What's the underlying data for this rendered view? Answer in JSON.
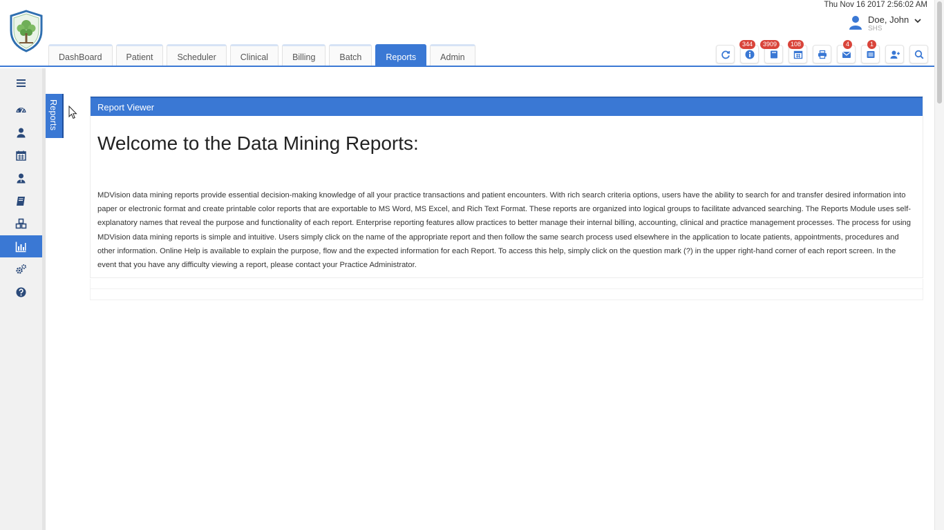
{
  "header": {
    "datetime": "Thu Nov 16 2017 2:56:02 AM",
    "user_name": "Doe, John",
    "user_org": "SHS",
    "logo_icon": "tree-shield-logo"
  },
  "tabs": [
    {
      "label": "DashBoard",
      "active": false
    },
    {
      "label": "Patient",
      "active": false
    },
    {
      "label": "Scheduler",
      "active": false
    },
    {
      "label": "Clinical",
      "active": false
    },
    {
      "label": "Billing",
      "active": false
    },
    {
      "label": "Batch",
      "active": false
    },
    {
      "label": "Reports",
      "active": true
    },
    {
      "label": "Admin",
      "active": false
    }
  ],
  "toolbar": [
    {
      "icon": "refresh-icon",
      "badge": ""
    },
    {
      "icon": "info-icon",
      "badge": "344"
    },
    {
      "icon": "book-icon",
      "badge": "3909"
    },
    {
      "icon": "calendar-icon",
      "badge": "108"
    },
    {
      "icon": "print-icon",
      "badge": ""
    },
    {
      "icon": "mail-icon",
      "badge": "4"
    },
    {
      "icon": "list-icon",
      "badge": "1"
    },
    {
      "icon": "add-user-icon",
      "badge": ""
    },
    {
      "icon": "search-icon",
      "badge": ""
    }
  ],
  "sidebar": [
    {
      "icon": "menu-icon",
      "active": false
    },
    {
      "icon": "dashboard-icon",
      "active": false
    },
    {
      "icon": "patient-icon",
      "active": false
    },
    {
      "icon": "calendar-icon",
      "active": false
    },
    {
      "icon": "clinical-user-icon",
      "active": false
    },
    {
      "icon": "billing-book-icon",
      "active": false
    },
    {
      "icon": "batch-cubes-icon",
      "active": false
    },
    {
      "icon": "reports-chart-icon",
      "active": true
    },
    {
      "icon": "admin-gears-icon",
      "active": false
    },
    {
      "icon": "help-icon",
      "active": false
    }
  ],
  "side_tab": {
    "label": "Reports"
  },
  "report_viewer": {
    "header": "Report Viewer",
    "title": "Welcome to the Data Mining Reports:",
    "body": "MDVision data mining reports provide essential decision-making knowledge of all your practice transactions and patient encounters. With rich search criteria options, users have the ability to search for and transfer desired information into paper or electronic format and create printable color reports that are exportable to MS Word, MS Excel, and Rich Text Format. These reports are organized into logical groups to facilitate advanced searching. The Reports Module uses self-explanatory names that reveal the purpose and functionality of each report. Enterprise reporting features allow practices to better manage their internal billing, accounting, clinical and practice management processes. The process for using MDVision data mining reports is simple and intuitive. Users simply click on the name of the appropriate report and then follow the same search process used elsewhere in the application to locate patients, appointments, procedures and other information. Online Help is available to explain the purpose, flow and the expected information for each Report. To access this help, simply click on the question mark (?) in the upper right-hand corner of each report screen. In the event that you have any difficulty viewing a report, please contact your Practice Administrator."
  },
  "colors": {
    "accent": "#3a78d4",
    "badge": "#d9443a",
    "icon": "#2b4a7a"
  }
}
